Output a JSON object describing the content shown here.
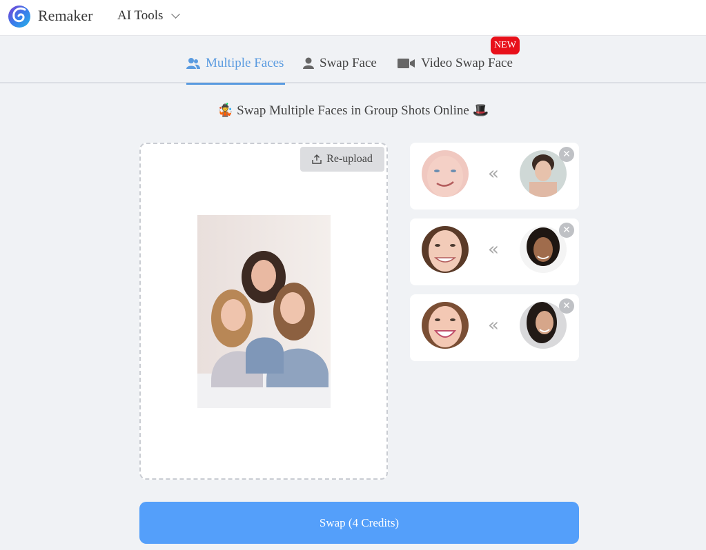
{
  "header": {
    "brand": "Remaker",
    "menu_label": "AI Tools",
    "logo_icon": "remaker-swirl-logo",
    "menu_icon": "chevron-down-icon"
  },
  "tabs": [
    {
      "label": "Multiple Faces",
      "icon": "users-icon",
      "active": true
    },
    {
      "label": "Swap Face",
      "icon": "user-icon",
      "active": false
    },
    {
      "label": "Video Swap Face",
      "icon": "video-camera-icon",
      "active": false,
      "badge": "NEW"
    }
  ],
  "headline": {
    "prefix_emoji": "🤹",
    "text": "Swap Multiple Faces in Group Shots Online",
    "suffix_emoji": "🎩"
  },
  "upload": {
    "reupload_label": "Re-upload",
    "reupload_icon": "upload-icon",
    "image_alt": "group photo of three smiling women"
  },
  "face_pairs": [
    {
      "source": "detected face 1",
      "target": "replacement face 1",
      "arrow": "«",
      "close": "✕"
    },
    {
      "source": "detected face 2",
      "target": "replacement face 2",
      "arrow": "«",
      "close": "✕"
    },
    {
      "source": "detected face 3",
      "target": "replacement face 3",
      "arrow": "«",
      "close": "✕"
    }
  ],
  "swap_button": {
    "label": "Swap (4 Credits)"
  },
  "colors": {
    "accent": "#549ffa",
    "tab_active": "#5a9be0",
    "badge": "#e8101a"
  }
}
